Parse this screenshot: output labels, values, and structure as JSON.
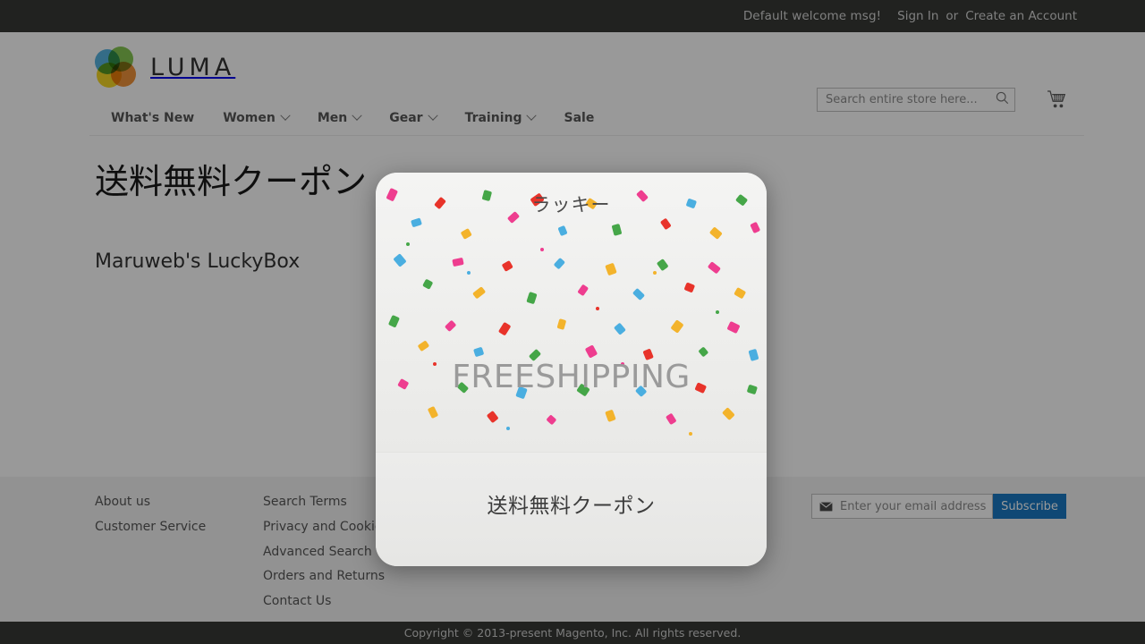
{
  "panel": {
    "welcome": "Default welcome msg!",
    "sign_in": "Sign In",
    "or": "or",
    "create_account": "Create an Account"
  },
  "header": {
    "logo_text": "LUMA",
    "search_placeholder": "Search entire store here...",
    "search_value": "",
    "search_icon": "search-icon",
    "cart_icon": "cart-icon"
  },
  "nav": {
    "items": [
      {
        "label": "What's New",
        "has_caret": false
      },
      {
        "label": "Women",
        "has_caret": true
      },
      {
        "label": "Men",
        "has_caret": true
      },
      {
        "label": "Gear",
        "has_caret": true
      },
      {
        "label": "Training",
        "has_caret": true
      },
      {
        "label": "Sale",
        "has_caret": false
      }
    ]
  },
  "content": {
    "title": "送料無料クーポン",
    "subtitle": "Maruweb's LuckyBox"
  },
  "modal": {
    "lucky_text": "ラッキー",
    "coupon_code": "FREESHIPPING",
    "caption": "送料無料クーポン"
  },
  "footer": {
    "col1": [
      "About us",
      "Customer Service"
    ],
    "col2": [
      "Search Terms",
      "Privacy and Cookie Policy",
      "Advanced Search",
      "Orders and Returns",
      "Contact Us"
    ],
    "newsletter": {
      "icon": "envelope-icon",
      "placeholder": "Enter your email address",
      "value": "",
      "button_label": "Subscribe"
    },
    "copyright": "Copyright © 2013-present Magento, Inc. All rights reserved."
  },
  "colors": {
    "panel_bg": "#373a36",
    "accent_blue": "#1979c3",
    "text_dark": "#333333",
    "overlay": "rgba(0,0,0,0.4)"
  }
}
